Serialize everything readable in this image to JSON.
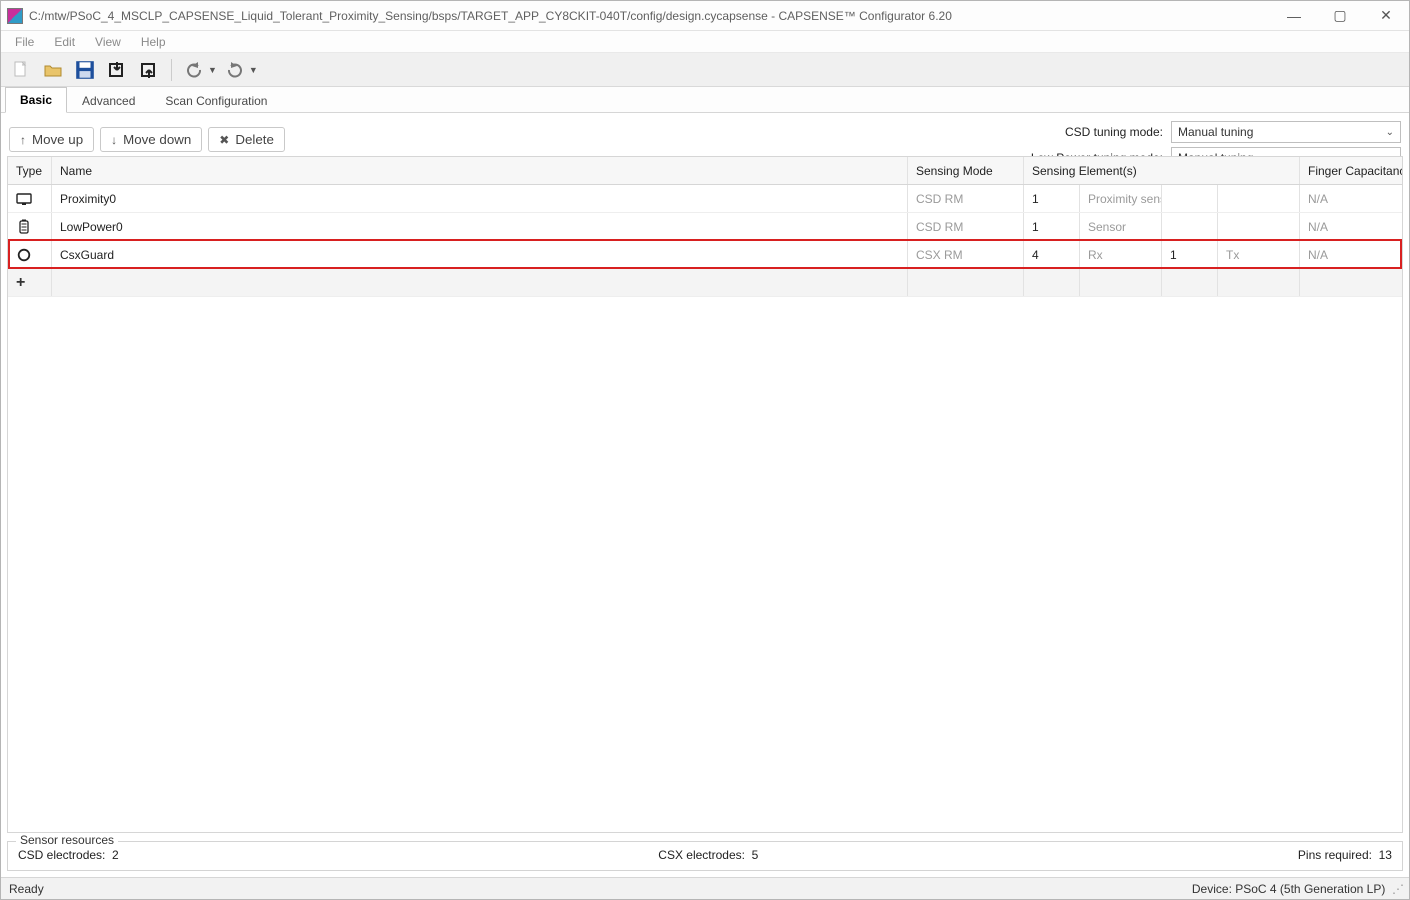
{
  "window": {
    "title": "C:/mtw/PSoC_4_MSCLP_CAPSENSE_Liquid_Tolerant_Proximity_Sensing/bsps/TARGET_APP_CY8CKIT-040T/config/design.cycapsense - CAPSENSE™ Configurator 6.20",
    "minimize": "—",
    "maximize": "▢",
    "close": "✕"
  },
  "menu": [
    "File",
    "Edit",
    "View",
    "Help"
  ],
  "toolbar": {
    "new": "new-file-icon",
    "open": "open-folder-icon",
    "save": "save-disk-icon",
    "import": "import-icon",
    "export": "export-icon",
    "undo": "undo-icon",
    "redo": "redo-icon"
  },
  "tabs": [
    {
      "label": "Basic",
      "active": true
    },
    {
      "label": "Advanced",
      "active": false
    },
    {
      "label": "Scan Configuration",
      "active": false
    }
  ],
  "buttons": {
    "move_up": "Move up",
    "move_down": "Move down",
    "delete": "Delete"
  },
  "tuning": {
    "csd_label": "CSD tuning mode:",
    "csd_value": "Manual tuning",
    "lp_label": "Low Power tuning mode:",
    "lp_value": "Manual tuning"
  },
  "headers": {
    "type": "Type",
    "name": "Name",
    "mode": "Sensing Mode",
    "elements": "Sensing Element(s)",
    "finger": "Finger Capacitance"
  },
  "rows": [
    {
      "icon": "proximity-icon",
      "name": "Proximity0",
      "mode": "CSD RM",
      "count1": "1",
      "label1": "Proximity sensor",
      "count2": "",
      "label2": "",
      "finger": "N/A",
      "highlight": false
    },
    {
      "icon": "lowpower-icon",
      "name": "LowPower0",
      "mode": "CSD RM",
      "count1": "1",
      "label1": "Sensor",
      "count2": "",
      "label2": "",
      "finger": "N/A",
      "highlight": false
    },
    {
      "icon": "button-icon",
      "name": "CsxGuard",
      "mode": "CSX RM",
      "count1": "4",
      "label1": "Rx",
      "count2": "1",
      "label2": "Tx",
      "finger": "N/A",
      "highlight": true
    }
  ],
  "resources": {
    "legend": "Sensor resources",
    "csd_label": "CSD electrodes:",
    "csd_val": "2",
    "csx_label": "CSX electrodes:",
    "csx_val": "5",
    "pins_label": "Pins required:",
    "pins_val": "13"
  },
  "status": {
    "left": "Ready",
    "right": "Device: PSoC 4 (5th Generation LP)"
  }
}
